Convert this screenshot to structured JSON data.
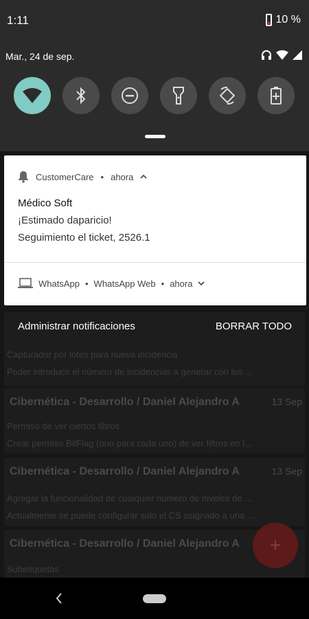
{
  "status_bar": {
    "time": "1:11",
    "battery": "10 %"
  },
  "quick_settings": {
    "date": "Mar., 24 de sep.",
    "tiles": [
      "wifi-icon",
      "bluetooth-icon",
      "do-not-disturb-icon",
      "flashlight-icon",
      "auto-rotate-icon",
      "battery-saver-icon"
    ]
  },
  "notifications": [
    {
      "app": "CustomerCare",
      "time": "ahora",
      "title": "Médico Soft",
      "lines": [
        "¡Estimado daparicio!",
        "Seguimiento el ticket, 2526.1"
      ]
    },
    {
      "app": "WhatsApp",
      "sub": "WhatsApp Web",
      "time": "ahora"
    }
  ],
  "actions": {
    "manage": "Administrar notificaciones",
    "clear_all": "BORRAR TODO"
  },
  "background_app": {
    "cards": [
      {
        "title": "",
        "date": "",
        "lines": [
          "Capturador por lotes para nueva incidencia",
          "Poder introducir el número de incidencias a generar con los ..."
        ]
      },
      {
        "title": "Cibernética - Desarrollo / Daniel Alejandro A",
        "date": "13 Sep",
        "lines": [
          "Permiso de ver ciertos filtros",
          "Crear permiso BitFlag (uno para cada uno) de ver filtros en l..."
        ]
      },
      {
        "title": "Cibernética - Desarrollo / Daniel Alejandro A",
        "date": "13 Sep",
        "lines": [
          "Agregar la funcionalidad de cualquier número de niveles de ...",
          "Actualmente se puede configurar solo el CS asignado a una ..."
        ]
      },
      {
        "title": "Cibernética - Desarrollo / Daniel Alejandro A",
        "date": "",
        "lines": [
          "Subetiquetas"
        ]
      }
    ],
    "fab_label": "+"
  }
}
